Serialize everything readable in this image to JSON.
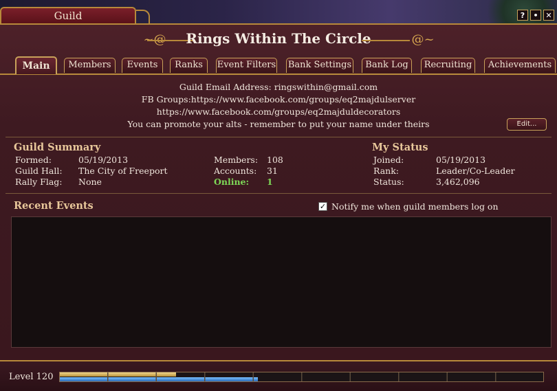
{
  "window": {
    "title": "Guild",
    "buttons": [
      "?",
      "•",
      "✕"
    ]
  },
  "guild_name": "Rings Within The Circle",
  "tabs": [
    {
      "label": "Main",
      "active": true
    },
    {
      "label": "Members"
    },
    {
      "label": "Events"
    },
    {
      "label": "Ranks"
    },
    {
      "label": "Event Filters"
    },
    {
      "label": "Bank Settings"
    },
    {
      "label": "Bank Log"
    },
    {
      "label": "Recruiting"
    },
    {
      "label": "Achievements"
    }
  ],
  "motd": [
    "Guild Email Address: ringswithin@gmail.com",
    "FB Groups:https://www.facebook.com/groups/eq2majdulserver",
    "https://www.facebook.com/groups/eq2majduldecorators",
    "You can promote your alts - remember to put your name under theirs"
  ],
  "edit_label": "Edit...",
  "guild_summary": {
    "heading": "Guild Summary",
    "formed_label": "Formed:",
    "formed": "05/19/2013",
    "hall_label": "Guild Hall:",
    "hall": "The City of Freeport",
    "rally_label": "Rally Flag:",
    "rally": "None",
    "members_label": "Members:",
    "members": "108",
    "accounts_label": "Accounts:",
    "accounts": "31",
    "online_label": "Online:",
    "online": "1"
  },
  "my_status": {
    "heading": "My Status",
    "joined_label": "Joined:",
    "joined": "05/19/2013",
    "rank_label": "Rank:",
    "rank": "Leader/Co-Leader",
    "status_label": "Status:",
    "status": "3,462,096"
  },
  "recent_events": {
    "heading": "Recent Events",
    "notify_label": "Notify me when guild members log on",
    "notify_checked": true,
    "items": []
  },
  "footer": {
    "level_label": "Level 120",
    "xp_progress": 0.24,
    "vitality_progress": 0.41
  },
  "colors": {
    "frame_gold": "#b8893a",
    "panel_bg": "#3e1a21",
    "online_green": "#7ed957",
    "heading_tan": "#e8c79a"
  }
}
